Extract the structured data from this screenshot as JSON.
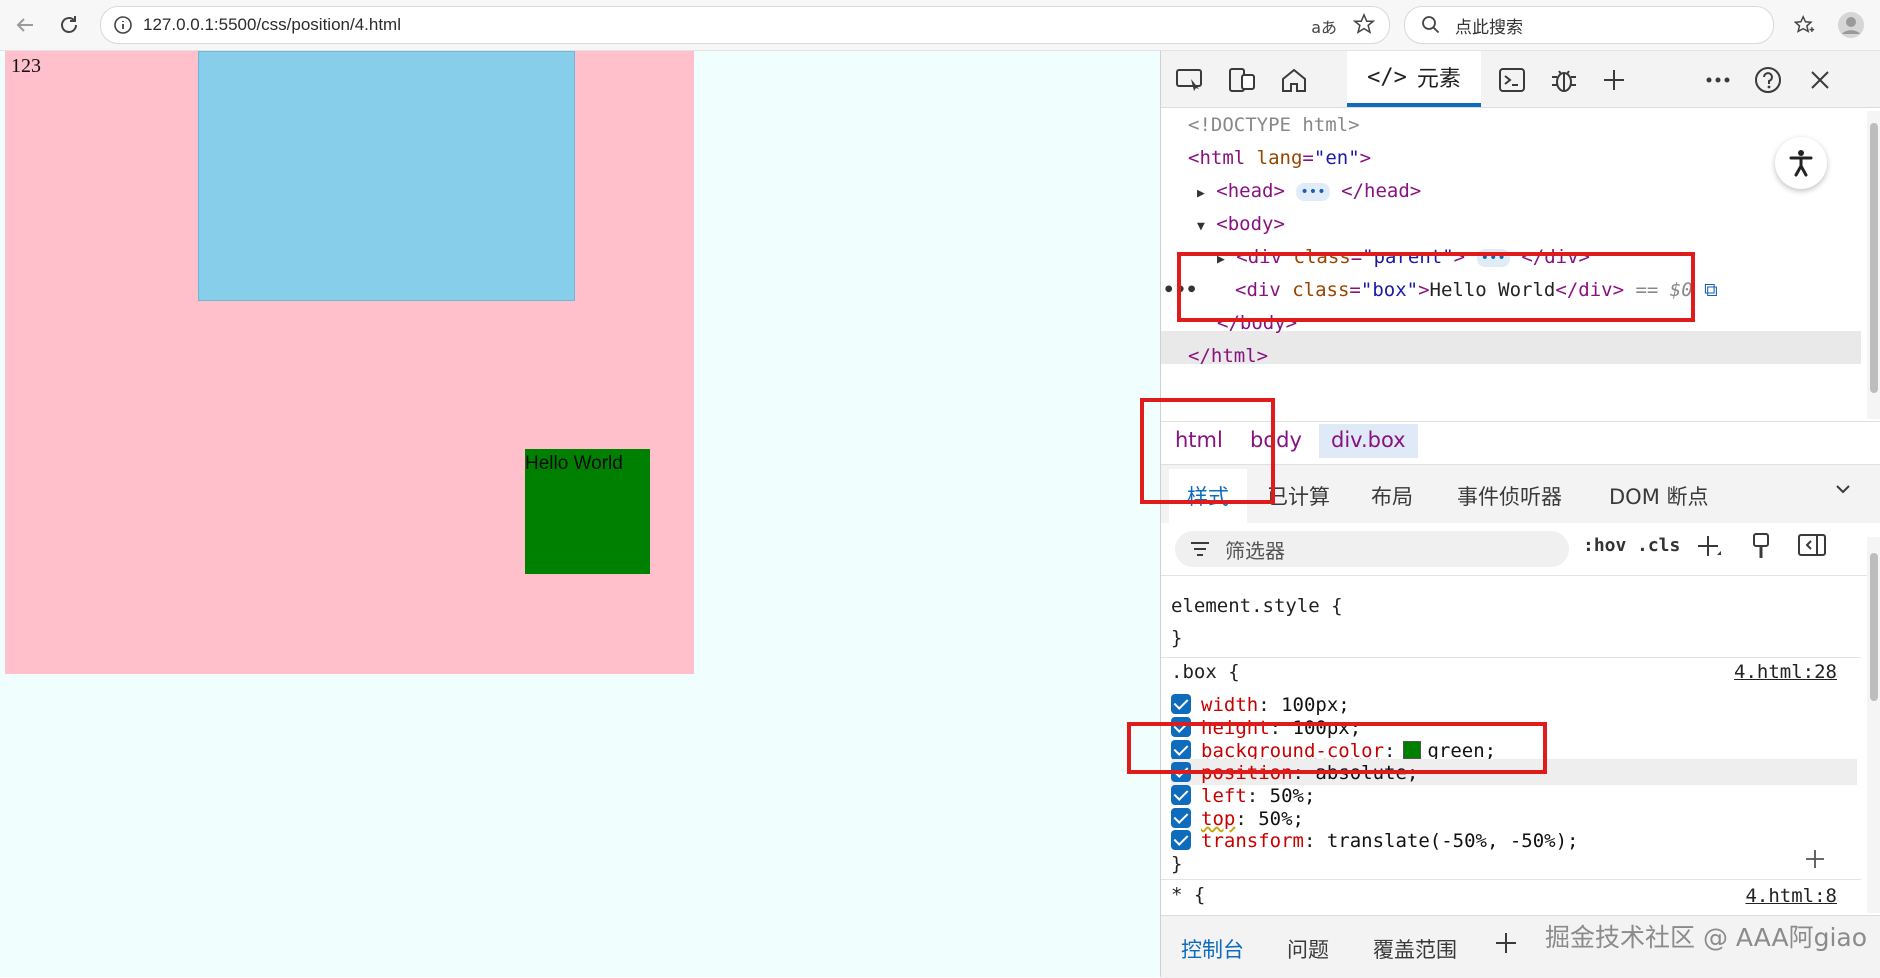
{
  "browser": {
    "url": "127.0.0.1:5500/css/position/4.html",
    "read_aloud": "aあ",
    "search_placeholder": "点此搜索"
  },
  "page": {
    "number_text": "123",
    "box_text": "Hello World",
    "colors": {
      "background": "#f0fffe",
      "parent": "#ffc0cb",
      "inner": "#87ceeb",
      "box": "#008000"
    }
  },
  "devtools": {
    "elements_tab": "元素",
    "dom_lines": {
      "doctype": "<!DOCTYPE html>",
      "html_open_tag": "<html",
      "html_attr": "lang",
      "html_val": "\"en\"",
      "head_open": "<head>",
      "head_close": "</head>",
      "body_open": "<body>",
      "div_parent_open": "<div",
      "div_parent_attr": "class",
      "div_parent_val": "\"parent\"",
      "div_parent_close": "</div>",
      "div_box_open": "<div",
      "div_box_attr": "class",
      "div_box_val": "\"box\"",
      "div_box_text": "Hello World",
      "div_box_close": "</div>",
      "selected_marker": "== $0",
      "body_close": "</body>",
      "html_close": "</html>"
    },
    "breadcrumbs": [
      "html",
      "body",
      "div.box"
    ],
    "sub_tabs": [
      "样式",
      "已计算",
      "布局",
      "事件侦听器",
      "DOM 断点"
    ],
    "filter_placeholder": "筛选器",
    "filter_hov": ":hov",
    "filter_cls": ".cls",
    "styles": {
      "element_style_selector": "element.style {",
      "close_brace": "}",
      "box_selector": ".box {",
      "box_source": "4.html:28",
      "declarations": [
        {
          "prop": "width",
          "value": "100px;"
        },
        {
          "prop": "height",
          "value": "100px;"
        },
        {
          "prop": "background-color",
          "value": "green;"
        },
        {
          "prop": "position",
          "value": "absolute;"
        },
        {
          "prop": "left",
          "value": "50%;"
        },
        {
          "prop": "top",
          "value": "50%;"
        },
        {
          "prop": "transform",
          "value": "translate(-50%, -50%);"
        }
      ],
      "universal_selector": "* {",
      "universal_source": "4.html:8"
    },
    "console_tabs": [
      "控制台",
      "问题",
      "覆盖范围"
    ]
  },
  "watermark": "掘金技术社区 @ AAA阿giao"
}
